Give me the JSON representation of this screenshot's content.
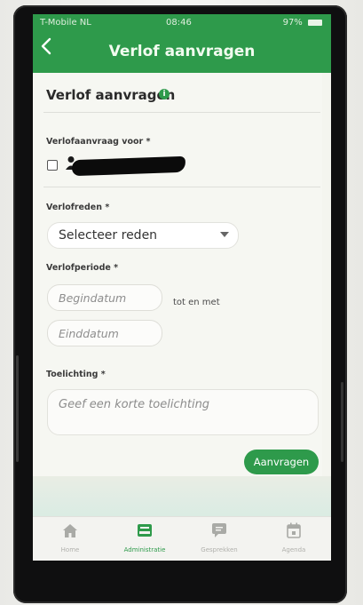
{
  "status_bar": {
    "carrier": "T-Mobile NL",
    "time": "08:46",
    "battery": "97%"
  },
  "app_bar": {
    "title": "Verlof aanvragen"
  },
  "form": {
    "title": "Verlof aanvragen",
    "request_for_label": "Verlofaanvraag voor *",
    "reason_label": "Verlofreden *",
    "reason_placeholder": "Selecteer reden",
    "period_label": "Verlofperiode *",
    "start_placeholder": "Begindatum",
    "between_text": "tot en met",
    "end_placeholder": "Einddatum",
    "note_label": "Toelichting *",
    "note_placeholder": "Geef een korte toelichting",
    "submit_label": "Aanvragen"
  },
  "bottom_nav": {
    "items": [
      {
        "label": "Home",
        "icon": "home-icon"
      },
      {
        "label": "Administratie",
        "icon": "inbox-tray-icon",
        "active": true
      },
      {
        "label": "Gesprekken",
        "icon": "chat-bubble-icon"
      },
      {
        "label": "Agenda",
        "icon": "calendar-icon"
      }
    ]
  },
  "colors": {
    "accent": "#2e9a4b",
    "background": "#f4f5ef"
  }
}
